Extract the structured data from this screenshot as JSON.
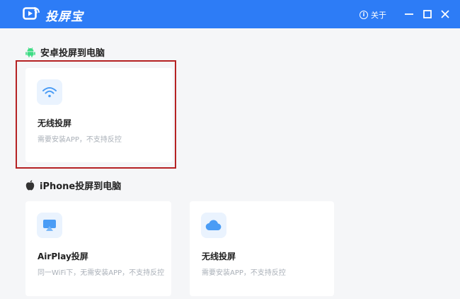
{
  "app": {
    "title": "投屏宝",
    "icon": "play-screen-icon"
  },
  "titlebar": {
    "about_label": "关于",
    "about_icon": "info-icon",
    "accent": "#2d7cf6"
  },
  "window_controls": [
    "minimize-icon",
    "maximize-icon",
    "close-icon"
  ],
  "android_section": {
    "title": "安卓投屏到电脑",
    "icon": "android-icon",
    "cards": [
      {
        "title": "无线投屏",
        "desc": "需要安装APP，不支持反控",
        "icon": "wifi-icon"
      }
    ]
  },
  "iphone_section": {
    "title": "iPhone投屏到电脑",
    "icon": "apple-icon",
    "cards": [
      {
        "title": "AirPlay投屏",
        "desc": "同一WiFi下，无需安装APP，不支持反控",
        "icon": "airplay-icon"
      },
      {
        "title": "无线投屏",
        "desc": "需要安装APP，不支持反控",
        "icon": "cloud-icon"
      }
    ]
  },
  "highlight_color": "#b52223"
}
